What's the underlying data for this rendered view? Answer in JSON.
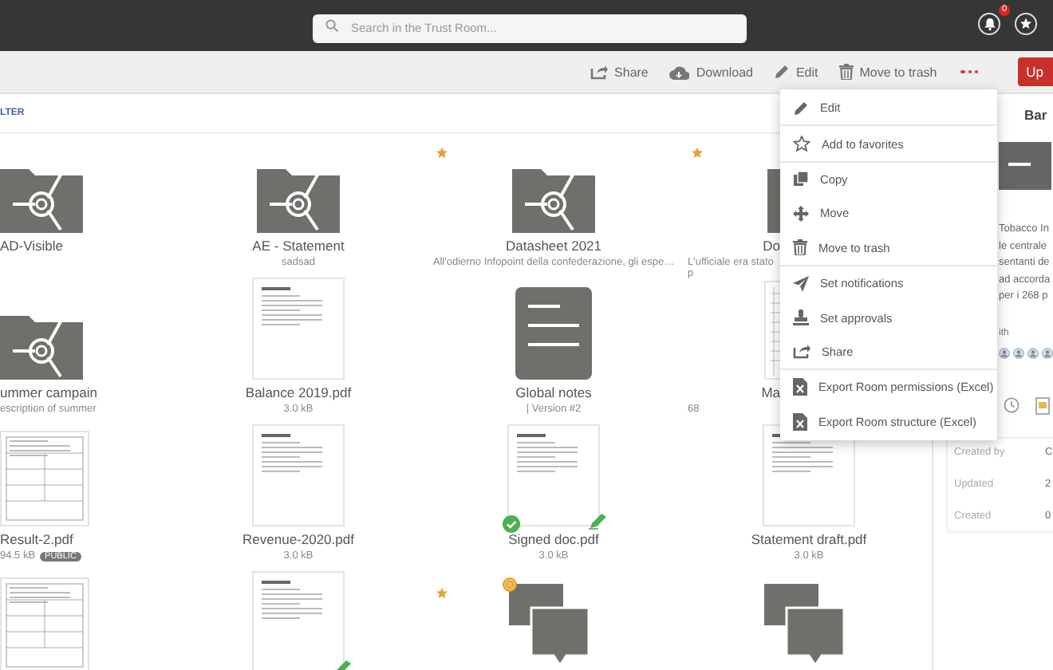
{
  "topbar": {
    "search": {
      "placeholder": "Search in the Trust Room..."
    },
    "notifications": {
      "badge": "0"
    }
  },
  "toolbar": {
    "actions": [
      {
        "label": "Share",
        "kind": "share"
      },
      {
        "label": "Download",
        "kind": "download"
      },
      {
        "label": "Edit",
        "kind": "edit"
      },
      {
        "label": "Move to trash",
        "kind": "trash"
      }
    ],
    "upload_button": "Up"
  },
  "filter": {
    "label": "LTER"
  },
  "items": [
    {
      "kind": "folder",
      "name": "AD-Visible",
      "favorite": false,
      "approved": false,
      "signed": false,
      "coin": false
    },
    {
      "kind": "folder",
      "name": "AE - Statement",
      "subtitle": "sadsad",
      "favorite": false,
      "approved": false,
      "signed": false,
      "coin": false
    },
    {
      "kind": "folder",
      "name": "Datasheet 2021",
      "subtitle": "All'odierno Infopoint della confederazione, gli espe…",
      "favorite": true,
      "approved": false,
      "signed": false,
      "coin": false
    },
    {
      "kind": "folder",
      "name": "Do",
      "subtitle": "L'ufficiale era stato p",
      "favorite": true,
      "approved": false,
      "signed": false,
      "coin": false
    },
    {
      "kind": "folder",
      "name": "ummer campain",
      "subtitle": "escription of summer",
      "favorite": false,
      "approved": false,
      "signed": false,
      "coin": false
    },
    {
      "kind": "pdf",
      "name": "Balance 2019.pdf",
      "subtitle": "3.0 kB",
      "favorite": false,
      "approved": false,
      "signed": false,
      "coin": false
    },
    {
      "kind": "note",
      "name": "Global notes",
      "subtitle": "| Version #2",
      "favorite": false,
      "approved": false,
      "signed": false,
      "coin": false
    },
    {
      "kind": "sheet",
      "name": "Ma",
      "subtitle": "68",
      "favorite": false,
      "approved": false,
      "signed": false,
      "coin": false
    },
    {
      "kind": "form",
      "name": "Result-2.pdf",
      "subtitle": "94.5 kB",
      "badge": "PUBLIC",
      "favorite": false,
      "approved": false,
      "signed": false,
      "coin": false
    },
    {
      "kind": "pdf",
      "name": "Revenue-2020.pdf",
      "subtitle": "3.0 kB",
      "favorite": false,
      "approved": false,
      "signed": false,
      "coin": false
    },
    {
      "kind": "pdf",
      "name": "Signed doc.pdf",
      "subtitle": "3.0 kB",
      "favorite": false,
      "approved": true,
      "signed": true,
      "coin": false
    },
    {
      "kind": "pdf",
      "name": "Statement draft.pdf",
      "subtitle": "3.0 kB",
      "favorite": false,
      "approved": false,
      "signed": false,
      "coin": false
    },
    {
      "kind": "form",
      "favorite": false,
      "approved": false,
      "signed": false,
      "coin": false
    },
    {
      "kind": "pdf",
      "favorite": false,
      "approved": false,
      "signed": true,
      "coin": false
    },
    {
      "kind": "chat",
      "favorite": true,
      "approved": false,
      "signed": false,
      "coin": true
    },
    {
      "kind": "chat",
      "favorite": false,
      "approved": false,
      "signed": false,
      "coin": false
    }
  ],
  "menu": {
    "groups": [
      [
        {
          "label": "Edit",
          "kind": "edit"
        }
      ],
      [
        {
          "label": "Add to favorites",
          "kind": "star"
        }
      ],
      [
        {
          "label": "Copy",
          "kind": "copy"
        },
        {
          "label": "Move",
          "kind": "move"
        },
        {
          "label": "Move to trash",
          "kind": "trash"
        }
      ],
      [
        {
          "label": "Set notifications",
          "kind": "send"
        },
        {
          "label": "Set approvals",
          "kind": "stamp"
        },
        {
          "label": "Share",
          "kind": "share"
        }
      ],
      [
        {
          "label": "Export Room permissions (Excel)",
          "kind": "excel"
        },
        {
          "label": "Export Room structure (Excel)",
          "kind": "excel"
        }
      ]
    ]
  },
  "panel": {
    "title": "Bar",
    "description_lines": [
      "Tobacco In",
      "le centrale",
      "sentanti de",
      "ad accorda",
      "per i 268 p"
    ],
    "shared_label": "ith",
    "details": [
      {
        "label": "Created by",
        "value": "C"
      },
      {
        "label": "Updated",
        "value": "2"
      },
      {
        "label": "Created",
        "value": "0"
      }
    ]
  }
}
